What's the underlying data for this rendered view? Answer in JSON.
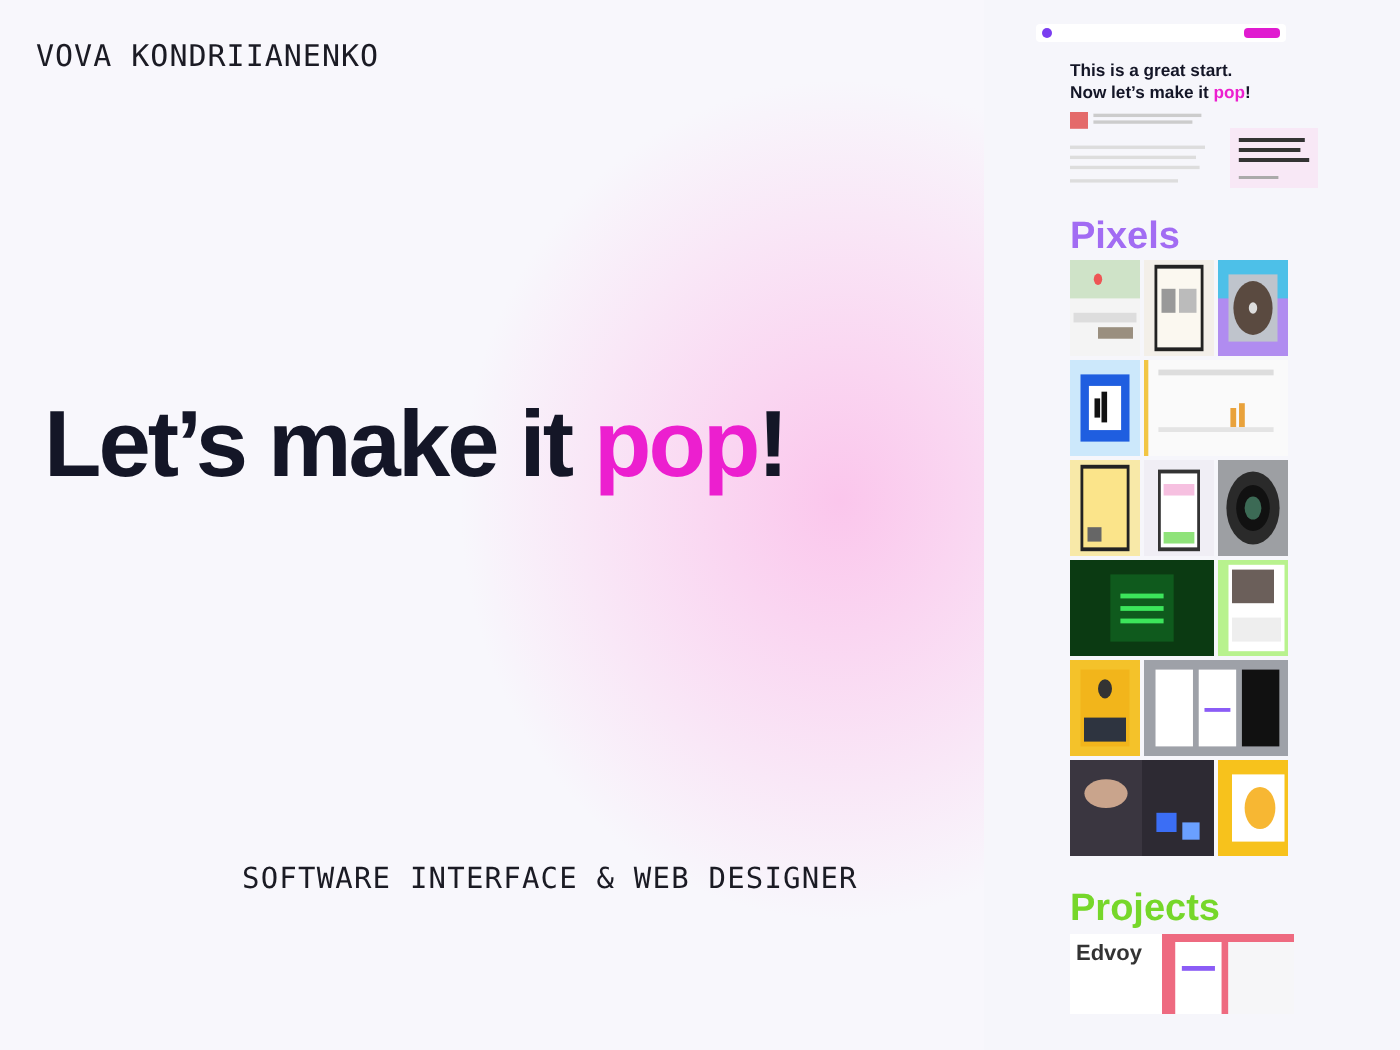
{
  "author": "VOVA KONDRIIANENKO",
  "headline": {
    "before": "Let’s make it ",
    "highlight": "pop",
    "after": "!"
  },
  "subtitle": "SOFTWARE INTERFACE & WEB DESIGNER",
  "preview": {
    "hero": {
      "line1": "This is a great start.",
      "before": "Now let’s make it ",
      "highlight": "pop",
      "after": "!"
    },
    "pixels_title": "Pixels",
    "projects_title": "Projects",
    "projects": [
      {
        "name": "Edvoy"
      }
    ]
  }
}
